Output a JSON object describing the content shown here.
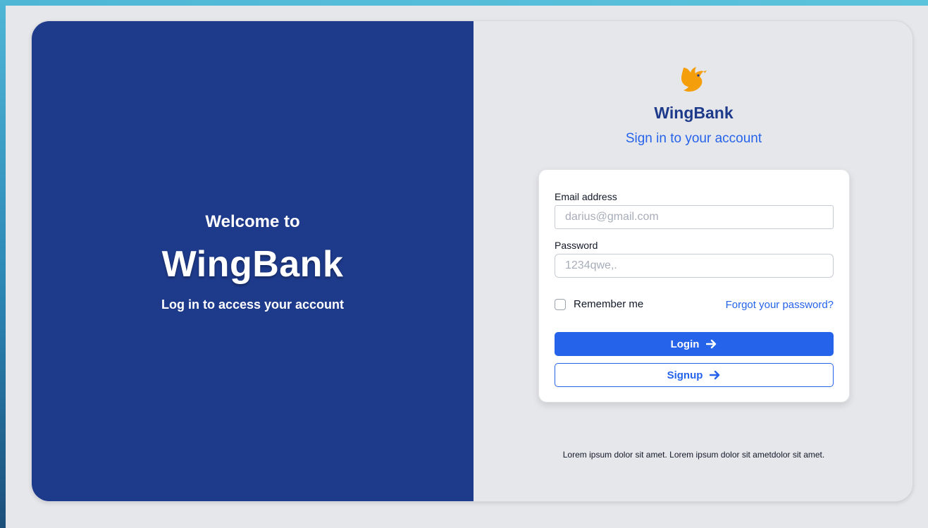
{
  "left_panel": {
    "welcome": "Welcome to",
    "brand": "WingBank",
    "tagline": "Log in to access your account"
  },
  "right_panel": {
    "logo_icon": "bird-icon",
    "brand": "WingBank",
    "subtitle": "Sign in to your account"
  },
  "form": {
    "email_label": "Email address",
    "email_placeholder": "darius@gmail.com",
    "password_label": "Password",
    "password_placeholder": "1234qwe,.",
    "remember_label": "Remember me",
    "forgot_link": "Forgot your password?",
    "login_label": "Login",
    "signup_label": "Signup",
    "arrow_icon": "arrow-right-icon"
  },
  "footer": {
    "text": "Lorem ipsum dolor sit amet. Lorem ipsum dolor sit ametdolor sit amet."
  },
  "colors": {
    "brand_navy": "#1e3a8a",
    "accent_blue": "#2563eb",
    "logo_orange": "#f59e0b",
    "background": "#e6e7eb"
  }
}
